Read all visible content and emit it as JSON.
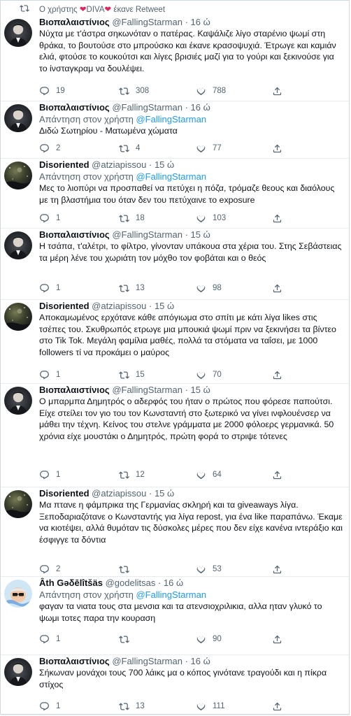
{
  "retweet_banner": {
    "prefix": "Ο χρήστης ",
    "heart": "❤",
    "user": "DIVA",
    "suffix": " έκανε Retweet"
  },
  "tweets": [
    {
      "name": "Βιοπαλαιστίνιος",
      "handle": "@FallingStarman",
      "time": "· 16 ώ",
      "reply_prefix": "",
      "reply_mention": "",
      "text": "Νύχτα με τ'άστρα σηκωνόταν ο πατέρας. Καψάλιζε λίγο σταρένιο ψωμί στη θράκα, το βουτούσε στο μπρούσκο και έκανε κρασοψυχιά. Έτρωγε και καμιάν ελιά, φτούσε το κουκούτσι και λίγες βρισιές μαζί για το γούρι και ξεκινούσε για το ίνσταγκραμ να δουλέψει.",
      "counts": {
        "reply": "19",
        "retweet": "308",
        "like": "788"
      },
      "avatar": "man"
    },
    {
      "name": "Βιοπαλαιστίνιος",
      "handle": "@FallingStarman",
      "time": "· 16 ώ",
      "reply_prefix": "Απάντηση στον χρήστη ",
      "reply_mention": "@FallingStarman",
      "text": "Διδώ Σωτηρίου - Ματωμένα χώματα",
      "counts": {
        "reply": "2",
        "retweet": "4",
        "like": "77"
      },
      "avatar": "man"
    },
    {
      "name": "Disoriented",
      "handle": "@atziapissou",
      "time": "· 15 ώ",
      "reply_prefix": "Απάντηση στον χρήστη ",
      "reply_mention": "@FallingStarman",
      "text": "Μες το λιοπύρι να προσπαθεί να πετύχει η πόζα, τρόμαζε θεους και διαόλους με τη βλαστήμια του όταν δεν του πετύχαινε το exposure",
      "counts": {
        "reply": "1",
        "retweet": "18",
        "like": "103"
      },
      "avatar": "night"
    },
    {
      "name": "Βιοπαλαιστίνιος",
      "handle": "@FallingStarman",
      "time": "· 15 ώ",
      "reply_prefix": "",
      "reply_mention": "",
      "text": "Η τσάπα, τ'αλέτρι, το φίλτρο, γίνονταν υπάκουα στα χέρια του. Στης Σεβάστειας τα μέρη λένε του χωριάτη τον μόχθο τον φοβάται και ο θεός",
      "counts": {
        "reply": "1",
        "retweet": "13",
        "like": "98"
      },
      "avatar": "man"
    },
    {
      "name": "Disoriented",
      "handle": "@atziapissou",
      "time": "· 15 ώ",
      "reply_prefix": "",
      "reply_mention": "",
      "text": "Αποκαμωμένος ερχότανε κάθε απόγιωμα στο σπίτι με κάτι λίγα likes στις τσέπες του. Σκυθρωπός ετρωγε μια μπουκιά ψωμί πριν να ξεκινήσει τα βίντεο στο Tik Tok. Μεγάλη φαμίλια μαθές, πολλά τα στόματα να ταΐσει, με 1000 followers τί να προκάμει ο μαύρος",
      "counts": {
        "reply": "1",
        "retweet": "15",
        "like": "70"
      },
      "avatar": "night"
    },
    {
      "name": "Βιοπαλαιστίνιος",
      "handle": "@FallingStarman",
      "time": "· 15 ώ",
      "reply_prefix": "",
      "reply_mention": "",
      "text": "Ο μπαρμπα Δημητρός ο αδερφός του ήταν ο πρώτος που φόρεσε παπούτσι. Είχε στείλει τον γιο του τον Κωνσταντή στο ξωτερικό να γίνει ινφλουένσερ να μάθει την τέχνη. Κείνος του στελνε γράμματα με 2000 φόλοερς γερμανικά. 50 χρόνια είχε μουστάκι ο Δημητρός, πρώτη φορά το στριψε τότενες",
      "counts": {
        "reply": "1",
        "retweet": "12",
        "like": "64"
      },
      "avatar": "man"
    },
    {
      "name": "Disoriented",
      "handle": "@atziapissou",
      "time": "· 15 ώ",
      "reply_prefix": "",
      "reply_mention": "",
      "text": "Μα πτανε η φάμπρικα της Γερμανίας σκληρή και τα giveaways λίγα. Ξεποδαριαζότανε ο Κωνσταντής για λίγα repost, για ένα like παραπάνω. Έκαμε να κιοτέψει, αλλά θυμόταν τις δύσκολες μέρες που δεν είχε κανένα ιντεράξιο και έσφιγγε τα δόντια",
      "counts": {
        "reply": "2",
        "retweet": "",
        "like": "53"
      },
      "avatar": "night"
    },
    {
      "name": "Ȃth Gəδēlîtšäs",
      "handle": "@godelitsas",
      "time": "· 16 ώ",
      "reply_prefix": "Απάντηση στον χρήστη ",
      "reply_mention": "@FallingStarman",
      "text": "φαγαν τα νιατα τους στα μενσια και τα ατενσιοχριλικια, αλλα ηταν γλυκό το ψωμι τοτες παρα την κουραση",
      "counts": {
        "reply": "1",
        "retweet": "",
        "like": "90"
      },
      "avatar": "ath"
    },
    {
      "name": "Βιοπαλαιστίνιος",
      "handle": "@FallingStarman",
      "time": "· 16 ώ",
      "reply_prefix": "",
      "reply_mention": "",
      "text": "Σήκωναν μονάχοι τους 700 λάικς μα ο κόπος γινότανε τραγούδι και η πίκρα στίχος",
      "counts": {
        "reply": "1",
        "retweet": "13",
        "like": "111"
      },
      "avatar": "man"
    }
  ]
}
